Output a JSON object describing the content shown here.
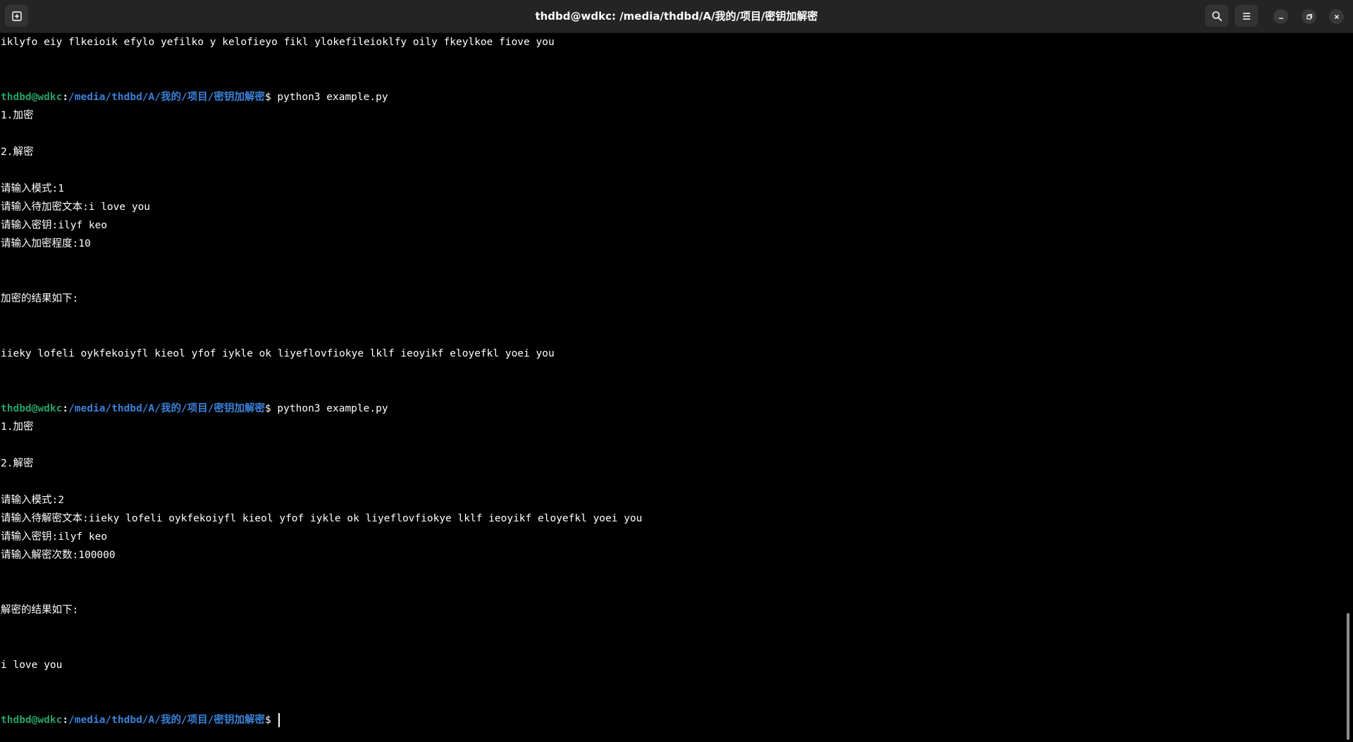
{
  "window": {
    "title": "thdbd@wdkc: /media/thdbd/A/我的/项目/密钥加解密",
    "icons": {
      "new_tab": "new-tab-icon",
      "search": "search-icon",
      "menu": "hamburger-menu-icon",
      "minimize": "minimize-icon",
      "maximize": "maximize-icon",
      "close": "close-icon"
    }
  },
  "prompt": {
    "user": "thdbd@wdkc",
    "colon": ":",
    "path": "/media/thdbd/A/我的/项目/密钥加解密",
    "dollar": "$ "
  },
  "colors": {
    "background": "#000000",
    "text": "#ffffff",
    "prompt_user": "#26a269",
    "prompt_path": "#3a81d8",
    "titlebar": "#242424"
  },
  "lines": [
    "iklyfo eiy flkeioik efylo yefilko y kelofieyo fikl ylokefileioklfy oily fkeylkoe fiove you",
    "",
    "",
    "python3 example.py",
    "1.加密",
    "",
    "2.解密",
    "",
    "请输入模式:1",
    "请输入待加密文本:i love you",
    "请输入密钥:ilyf keo",
    "请输入加密程度:10",
    "",
    "",
    "加密的结果如下:",
    "",
    "",
    "iieky lofeli oykfekoiyfl kieol yfof iykle ok liyeflovfiokye lklf ieoyikf eloyefkl yoei you",
    "",
    "",
    "python3 example.py",
    "1.加密",
    "",
    "2.解密",
    "",
    "请输入模式:2",
    "请输入待解密文本:iieky lofeli oykfekoiyfl kieol yfof iykle ok liyeflovfiokye lklf ieoyikf eloyefkl yoei you",
    "请输入密钥:ilyf keo",
    "请输入解密次数:100000",
    "",
    "",
    "解密的结果如下:",
    "",
    "",
    "i love you",
    "",
    "",
    ""
  ],
  "prompt_lines": [
    3,
    20,
    37
  ]
}
